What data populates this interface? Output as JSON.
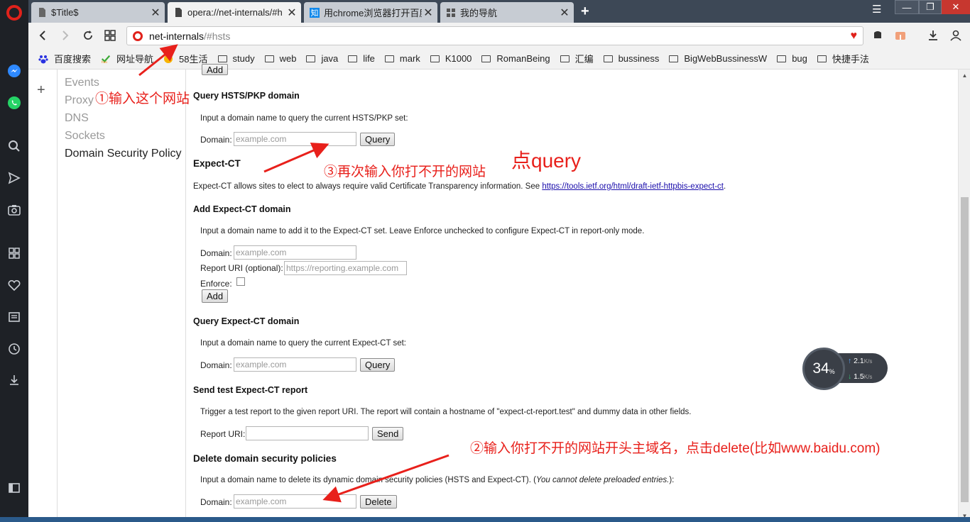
{
  "tabs": [
    {
      "title": "$Title$",
      "icon": "doc-icon"
    },
    {
      "title": "opera://net-internals/#h",
      "icon": "doc-icon"
    },
    {
      "title": "用chrome浏览器打开百度",
      "icon": "zhihu-icon",
      "icon_text": "知"
    },
    {
      "title": "我的导航",
      "icon": "grid-icon"
    }
  ],
  "address": {
    "host": "net-internals",
    "path": "/#hsts"
  },
  "bookmarks": [
    {
      "label": "百度搜索",
      "icon": "baidu-icon"
    },
    {
      "label": "网址导航",
      "icon": "hao-icon"
    },
    {
      "label": "58生活",
      "icon": "58-icon"
    },
    {
      "label": "study",
      "icon": "folder-icon"
    },
    {
      "label": "web",
      "icon": "folder-icon"
    },
    {
      "label": "java",
      "icon": "folder-icon"
    },
    {
      "label": "life",
      "icon": "folder-icon"
    },
    {
      "label": "mark",
      "icon": "folder-icon"
    },
    {
      "label": "K1000",
      "icon": "folder-icon"
    },
    {
      "label": "RomanBeing",
      "icon": "folder-icon"
    },
    {
      "label": "汇编",
      "icon": "folder-icon"
    },
    {
      "label": "bussiness",
      "icon": "folder-icon"
    },
    {
      "label": "BigWebBussinessW",
      "icon": "folder-icon"
    },
    {
      "label": "bug",
      "icon": "folder-icon"
    },
    {
      "label": "快捷手法",
      "icon": "folder-icon"
    }
  ],
  "sidenav": [
    "Events",
    "Proxy",
    "DNS",
    "Sockets",
    "Domain Security Policy"
  ],
  "page": {
    "add_button_partial": "Add",
    "query_hsts_title": "Query HSTS/PKP domain",
    "query_hsts_desc": "Input a domain name to query the current HSTS/PKP set:",
    "domain_label": "Domain:",
    "domain_placeholder": "example.com",
    "query_button": "Query",
    "expect_ct_title": "Expect-CT",
    "expect_ct_desc": "Expect-CT allows sites to elect to always require valid Certificate Transparency information. See ",
    "expect_ct_link": "https://tools.ietf.org/html/draft-ietf-httpbis-expect-ct",
    "expect_ct_desc_end": ".",
    "add_ct_title": "Add Expect-CT domain",
    "add_ct_desc": "Input a domain name to add it to the Expect-CT set. Leave Enforce unchecked to configure Expect-CT in report-only mode.",
    "report_uri_optional_label": "Report URI (optional):",
    "report_uri_placeholder": "https://reporting.example.com",
    "enforce_label": "Enforce:",
    "add_button": "Add",
    "query_ct_title": "Query Expect-CT domain",
    "query_ct_desc": "Input a domain name to query the current Expect-CT set:",
    "send_report_title": "Send test Expect-CT report",
    "send_report_desc": "Trigger a test report to the given report URI. The report will contain a hostname of \"expect-ct-report.test\" and dummy data in other fields.",
    "report_uri_label": "Report URI:",
    "send_button": "Send",
    "delete_title": "Delete domain security policies",
    "delete_desc": "Input a domain name to delete its dynamic domain security policies (HSTS and Expect-CT). (",
    "delete_desc_italic": "You cannot delete preloaded entries.",
    "delete_desc_end": "):",
    "delete_button": "Delete"
  },
  "speed_widget": {
    "percent": "34",
    "percent_sign": "%",
    "up": "2.1",
    "down": "1.5",
    "unit": "K/s"
  },
  "annotations": {
    "step1": "①输入这个网站",
    "step2": "②输入你打不开的网站开头主域名，点击delete(比如www.baidu.com)",
    "step3": "③再次输入你打不开的网站",
    "click_query": "点query"
  },
  "colors": {
    "annotation": "#e8201b",
    "opera_red": "#e0221b",
    "tabstrip": "#3d4856"
  }
}
